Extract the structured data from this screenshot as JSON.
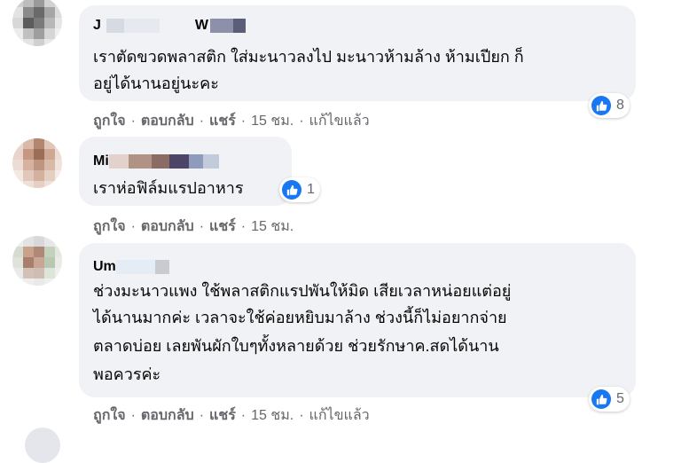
{
  "comments": [
    {
      "author_visible": "J",
      "author_tail": "W",
      "text_lines": [
        "เราตัดขวดพลาสติก ใส่มะนาวลงไป มะนาวห้ามล้าง ห้ามเปียก ก็",
        "อยู่ได้นานอยู่นะคะ"
      ],
      "like_count": "8",
      "actions": {
        "like": "ถูกใจ",
        "reply": "ตอบกลับ",
        "share": "แชร์",
        "time": "15 ชม.",
        "edited": "แก้ไขแล้ว"
      }
    },
    {
      "author_visible": "Mi",
      "text_lines": [
        "เราห่อฟิล์มแรปอาหาร"
      ],
      "like_count": "1",
      "actions": {
        "like": "ถูกใจ",
        "reply": "ตอบกลับ",
        "share": "แชร์",
        "time": "15 ชม."
      }
    },
    {
      "author_visible": "Um",
      "text_lines": [
        "ช่วงมะนาวแพง ใช้พลาสติกแรปพันให้มิด เสียเวลาหน่อยแต่อยู่",
        "ได้นานมากค่ะ เวลาจะใช้ค่อยหยิบมาล้าง ช่วงนี้ก็ไม่อยากจ่าย",
        "ตลาดบ่อย เลยพันผักใบๆทั้งหลายด้วย ช่วยรักษาค.สดได้นาน",
        "พอควรค่ะ"
      ],
      "like_count": "5",
      "actions": {
        "like": "ถูกใจ",
        "reply": "ตอบกลับ",
        "share": "แชร์",
        "time": "15 ชม.",
        "edited": "แก้ไขแล้ว"
      }
    }
  ],
  "colors": {
    "bubble": "#f0f2f5",
    "like_blue": "#1877f2",
    "meta_gray": "#65676b"
  },
  "icons": {
    "reaction": "thumbs-up-icon"
  }
}
